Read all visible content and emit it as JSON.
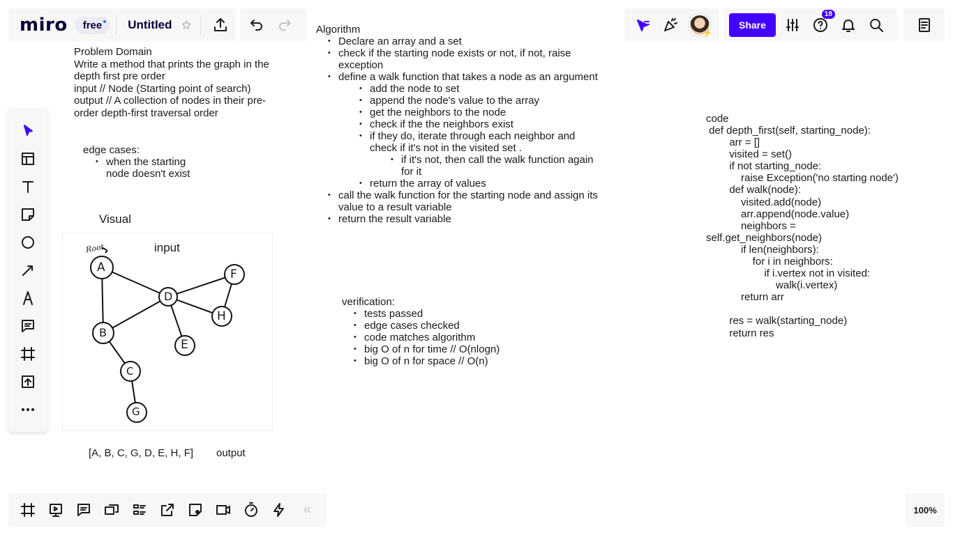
{
  "app": {
    "logo": "miro",
    "plan_badge": "free",
    "board_title": "Untitled",
    "share_label": "Share",
    "help_badge_count": "18",
    "zoom_level": "100%",
    "accent_color": "#4200ff"
  },
  "canvas": {
    "problem_domain": {
      "heading": "Problem Domain",
      "lines": [
        "Write a method that prints the graph in the",
        "depth first pre order",
        "input // Node (Starting point of search)",
        "output // A collection of nodes in their pre-",
        "order depth-first traversal order"
      ]
    },
    "edge_cases": {
      "heading": "edge cases:",
      "items": [
        "when the starting",
        "node doesn't exist"
      ]
    },
    "visual": {
      "heading": "Visual",
      "input_label": "input",
      "root_label": "Root",
      "nodes": [
        "A",
        "B",
        "C",
        "D",
        "E",
        "F",
        "G",
        "H"
      ],
      "output_value": "[A, B, C, G, D, E, H, F]",
      "output_label": "output"
    },
    "algorithm": {
      "heading": "Algorithm",
      "lines": [
        "Declare an array and a set",
        "check if the starting node exists or not, if not, raise",
        "exception",
        "define a walk function that takes a node as an argument",
        "add the node to set",
        "append the node's value to the array",
        "get the neighbors to the node",
        "check if the the neighbors exist",
        "if they do, iterate through each neighbor and",
        "check if it's not in the visited set .",
        "if it's not, then call the walk function again",
        "for it",
        "return the array of values",
        "call the walk function for the starting node and assign its",
        "value to a result variable",
        "return the result variable"
      ]
    },
    "verification": {
      "heading": "verification:",
      "items": [
        "tests passed",
        "edge cases checked",
        "code matches algorithm",
        "big O of n for time // O(nlogn)",
        "big O of n for space // O(n)"
      ]
    },
    "code": {
      "heading": "code",
      "lines": [
        " def depth_first(self, starting_node):",
        "        arr = []",
        "        visited = set()",
        "        if not starting_node:",
        "            raise Exception('no starting node')",
        "        def walk(node):",
        "            visited.add(node)",
        "            arr.append(node.value)",
        "            neighbors =",
        "self.get_neighbors(node)",
        "            if len(neighbors):",
        "                for i in neighbors:",
        "                    if i.vertex not in visited:",
        "                        walk(i.vertex)",
        "            return arr",
        "",
        "        res = walk(starting_node)",
        "        return res"
      ]
    }
  }
}
